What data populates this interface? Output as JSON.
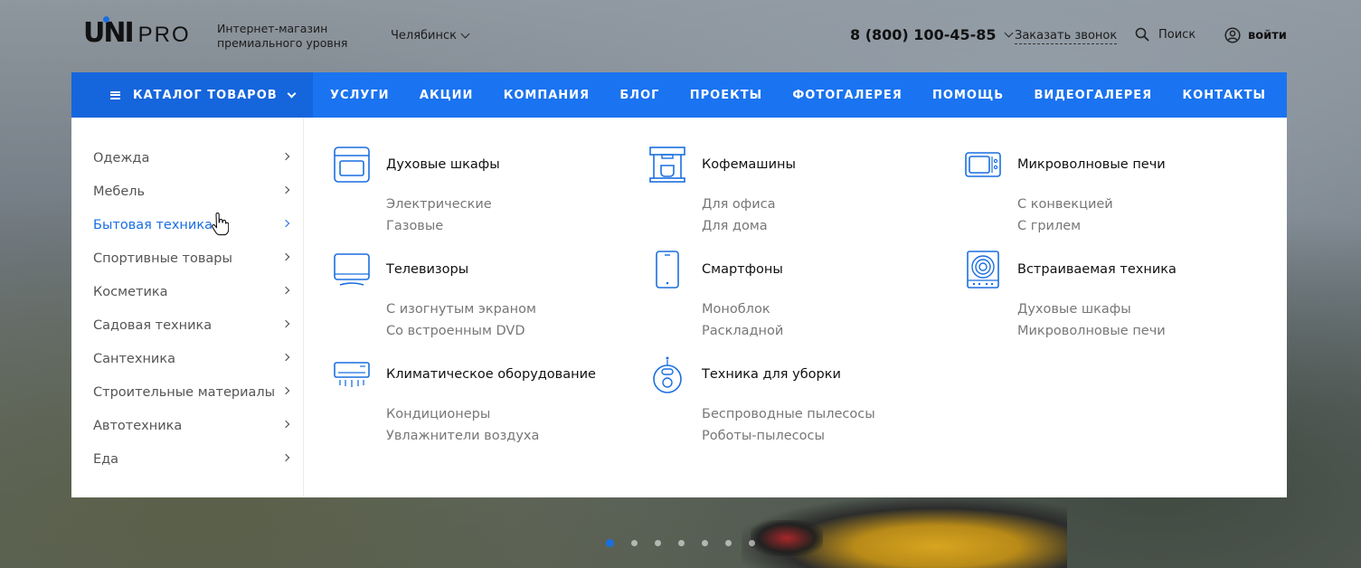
{
  "header": {
    "logo_main": "UNI",
    "logo_sub": "PRO",
    "tagline": "Интернет-магазин премиального уровня",
    "city": "Челябинск",
    "phone": "8 (800) 100-45-85",
    "callback_label": "Заказать звонок",
    "search_label": "Поиск",
    "login_label": "войти"
  },
  "nav": {
    "catalog_label": "КАТАЛОГ ТОВАРОВ",
    "items": [
      {
        "label": "УСЛУГИ"
      },
      {
        "label": "АКЦИИ"
      },
      {
        "label": "КОМПАНИЯ"
      },
      {
        "label": "БЛОГ"
      },
      {
        "label": "ПРОЕКТЫ"
      },
      {
        "label": "ФОТОГАЛЕРЕЯ"
      },
      {
        "label": "ПОМОЩЬ"
      },
      {
        "label": "ВИДЕОГАЛЕРЕЯ"
      },
      {
        "label": "КОНТАКТЫ"
      }
    ]
  },
  "categories": [
    {
      "label": "Одежда",
      "active": false
    },
    {
      "label": "Мебель",
      "active": false
    },
    {
      "label": "Бытовая техника",
      "active": true
    },
    {
      "label": "Спортивные товары",
      "active": false
    },
    {
      "label": "Косметика",
      "active": false
    },
    {
      "label": "Садовая техника",
      "active": false
    },
    {
      "label": "Сантехника",
      "active": false
    },
    {
      "label": "Строительные материалы",
      "active": false
    },
    {
      "label": "Автотехника",
      "active": false
    },
    {
      "label": "Еда",
      "active": false
    }
  ],
  "subgroups": [
    {
      "title": "Духовые шкафы",
      "icon": "oven-icon",
      "links": [
        "Электрические",
        "Газовые"
      ]
    },
    {
      "title": "Кофемашины",
      "icon": "coffee-machine-icon",
      "links": [
        "Для офиса",
        "Для дома"
      ]
    },
    {
      "title": "Микроволновые печи",
      "icon": "microwave-icon",
      "links": [
        "С конвекцией",
        "С грилем"
      ]
    },
    {
      "title": "Телевизоры",
      "icon": "tv-icon",
      "links": [
        "С изогнутым экраном",
        "Со встроенным DVD"
      ]
    },
    {
      "title": "Смартфоны",
      "icon": "smartphone-icon",
      "links": [
        "Моноблок",
        "Раскладной"
      ]
    },
    {
      "title": "Встраиваемая техника",
      "icon": "built-in-appliance-icon",
      "links": [
        "Духовые шкафы",
        "Микроволновые печи"
      ]
    },
    {
      "title": "Климатическое оборудование",
      "icon": "air-conditioner-icon",
      "links": [
        "Кондиционеры",
        "Увлажнители воздуха"
      ]
    },
    {
      "title": "Техника для уборки",
      "icon": "robot-vacuum-icon",
      "links": [
        "Беспроводные пылесосы",
        "Роботы-пылесосы"
      ]
    }
  ],
  "slider": {
    "count": 7,
    "active_index": 0
  },
  "colors": {
    "accent": "#1a73f0",
    "accent_dark": "#1565dc",
    "link_active": "#1a6fe0"
  }
}
